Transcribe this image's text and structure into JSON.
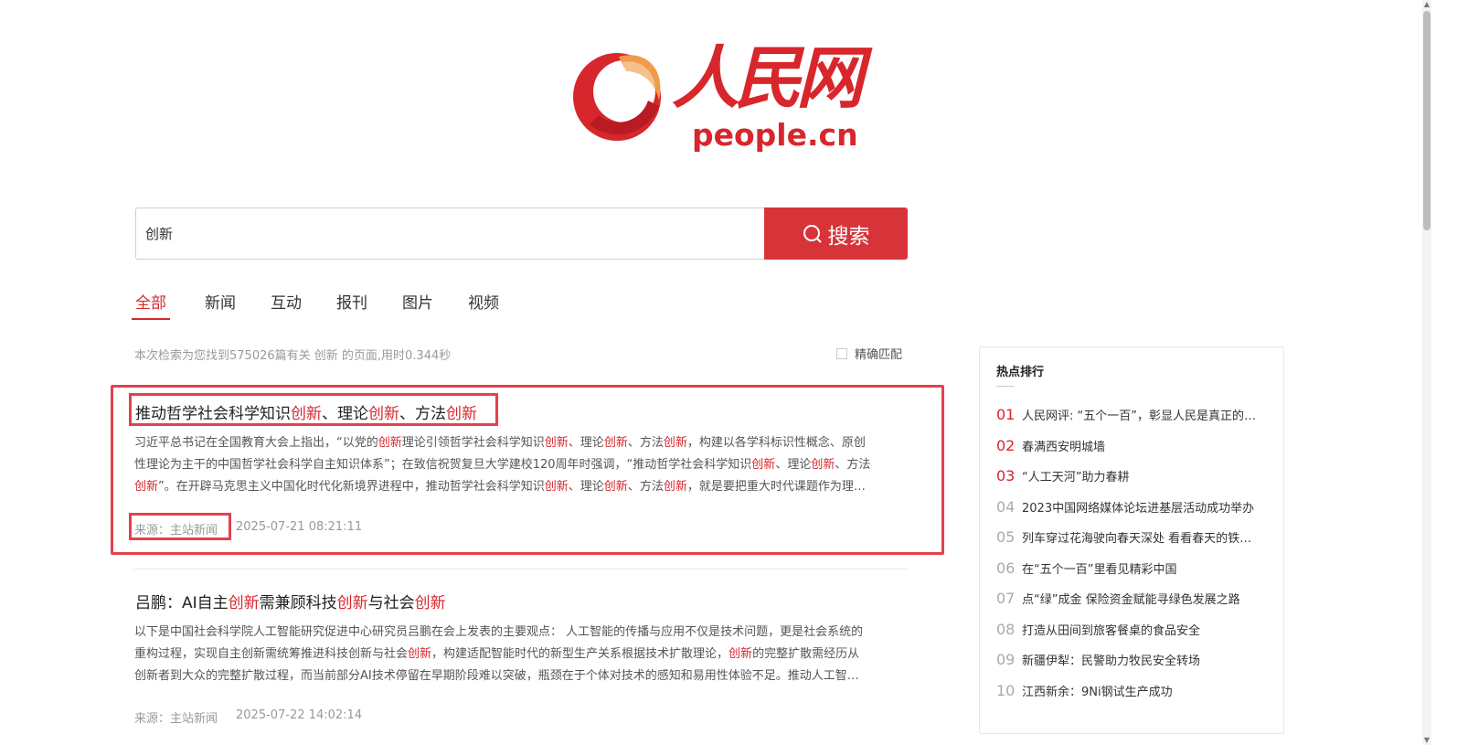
{
  "logo": {
    "chinese": "人民网",
    "domain": "people.cn"
  },
  "search": {
    "query": "创新",
    "button_label": "搜索"
  },
  "tabs": [
    {
      "label": "全部",
      "active": true
    },
    {
      "label": "新闻",
      "active": false
    },
    {
      "label": "互动",
      "active": false
    },
    {
      "label": "报刊",
      "active": false
    },
    {
      "label": "图片",
      "active": false
    },
    {
      "label": "视频",
      "active": false
    }
  ],
  "summary": "本次检索为您找到575026篇有关 创新 的页面,用时0.344秒",
  "exact_match_label": "精确匹配",
  "results": [
    {
      "title_parts": [
        "推动哲学社会科学知识",
        "创新",
        "、理论",
        "创新",
        "、方法",
        "创新"
      ],
      "snippet_lines": [
        [
          "习近平总书记在全国教育大会上指出，“以党的",
          "创新",
          "理论引领哲学社会科学知识",
          "创新",
          "、理论",
          "创新",
          "、方法",
          "创新",
          "，构建以各学科标识性概念、原创"
        ],
        [
          "性理论为主干的中国哲学社会科学自主知识体系”；在致信祝贺复旦大学建校120周年时强调，“推动哲学社会科学知识",
          "创新",
          "、理论",
          "创新",
          "、方法"
        ],
        [
          "",
          "创新",
          "”。在开辟马克思主义中国化时代化新境界进程中，推动哲学社会科学知识",
          "创新",
          "、理论",
          "创新",
          "、方法",
          "创新",
          "，就是要把重大时代课题作为理…"
        ]
      ],
      "source": "来源：主站新闻",
      "date": "2025-07-21 08:21:11"
    },
    {
      "title_parts": [
        "吕鹏：AI自主",
        "创新",
        "需兼顾科技",
        "创新",
        "与社会",
        "创新"
      ],
      "snippet_lines": [
        [
          "以下是中国社会科学院人工智能研究促进中心研究员吕鹏在会上发表的主要观点： 人工智能的传播与应用不仅是技术问题，更是社会系统的"
        ],
        [
          "重构过程，实现自主创新需统筹推进科技创新与社会",
          "创新",
          "，构建适配智能时代的新型生产关系根据技术扩散理论，",
          "创新",
          "的完整扩散需经历从"
        ],
        [
          "创新者到大众的完整扩散过程，而当前部分AI技术停留在早期阶段难以突破，瓶颈在于个体对技术的感知和易用性体验不足。推动人工智…"
        ]
      ],
      "source": "来源：主站新闻",
      "date": "2025-07-22 14:02:14"
    }
  ],
  "hot": {
    "title": "热点排行",
    "items": [
      {
        "num": "01",
        "text": "人民网评: “五个一百”，彰显人民是真正的…"
      },
      {
        "num": "02",
        "text": "春满西安明城墙"
      },
      {
        "num": "03",
        "text": "“人工天河”助力春耕"
      },
      {
        "num": "04",
        "text": "2023中国网络媒体论坛进基层活动成功举办"
      },
      {
        "num": "05",
        "text": "列车穿过花海驶向春天深处 看看春天的铁…"
      },
      {
        "num": "06",
        "text": "在“五个一百”里看见精彩中国"
      },
      {
        "num": "07",
        "text": "点“绿”成金 保险资金赋能寻绿色发展之路"
      },
      {
        "num": "08",
        "text": "打造从田间到旅客餐桌的食品安全"
      },
      {
        "num": "09",
        "text": "新疆伊犁：民警助力牧民安全转场"
      },
      {
        "num": "10",
        "text": "江西新余：9Ni钢试生产成功"
      }
    ]
  },
  "colors": {
    "accent": "#d7262c",
    "button": "#d7343a",
    "highlight_border": "#e4414c"
  }
}
